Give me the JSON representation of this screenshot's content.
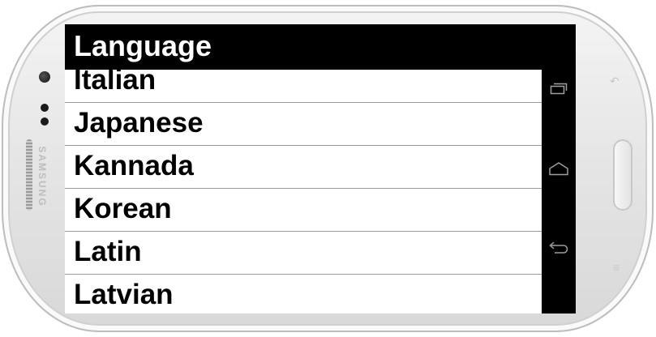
{
  "device": {
    "brand": "SAMSUNG"
  },
  "app": {
    "title": "Language",
    "items": [
      {
        "label": "Italian"
      },
      {
        "label": "Japanese"
      },
      {
        "label": "Kannada"
      },
      {
        "label": "Korean"
      },
      {
        "label": "Latin"
      },
      {
        "label": "Latvian"
      }
    ]
  },
  "nav": {
    "recents_icon": "recent-apps-icon",
    "home_icon": "home-icon",
    "back_icon": "back-icon"
  },
  "colors": {
    "screen_bg": "#000000",
    "list_bg": "#ffffff",
    "divider": "#9a9a9a",
    "nav_icon": "#9e9e9e"
  }
}
